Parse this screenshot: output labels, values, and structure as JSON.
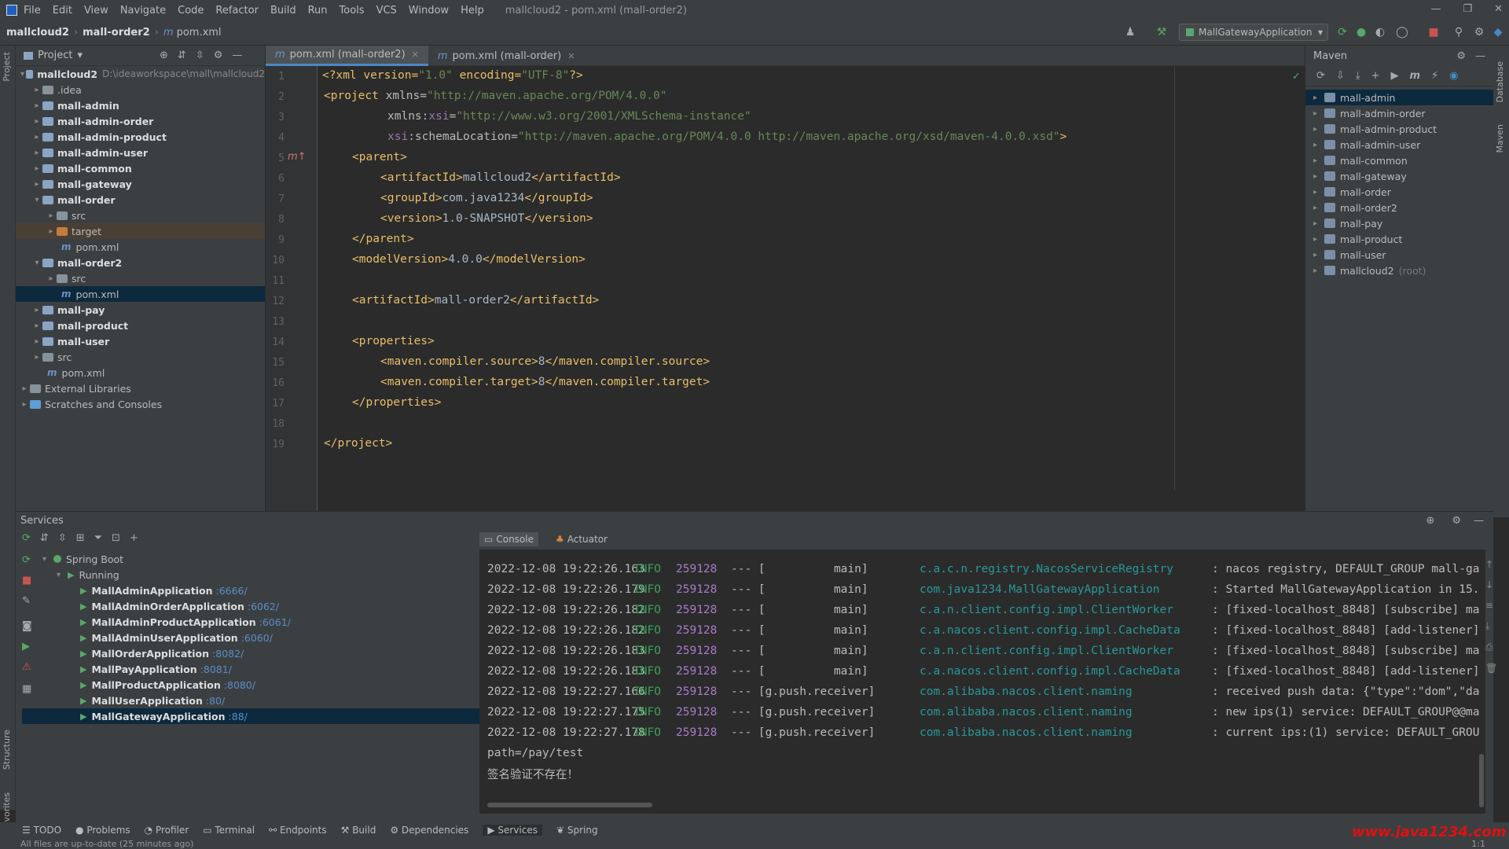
{
  "menu": {
    "items": [
      "File",
      "Edit",
      "View",
      "Navigate",
      "Code",
      "Refactor",
      "Build",
      "Run",
      "Tools",
      "VCS",
      "Window",
      "Help"
    ],
    "window_title": "mallcloud2 - pom.xml (mall-order2)"
  },
  "breadcrumb": [
    "mallcloud2",
    "mall-order2",
    "pom.xml"
  ],
  "run_config": "MallGatewayApplication",
  "project": {
    "header": "Project",
    "root_name": "mallcloud2",
    "root_path": "D:\\ideaworkspace\\mall\\mallcloud2",
    "items": [
      ".idea",
      "mall-admin",
      "mall-admin-order",
      "mall-admin-product",
      "mall-admin-user",
      "mall-common",
      "mall-gateway",
      "mall-order",
      "src",
      "target",
      "pom.xml",
      "mall-order2",
      "src",
      "pom.xml",
      "mall-pay",
      "mall-product",
      "mall-user",
      "src",
      "pom.xml",
      "External Libraries",
      "Scratches and Consoles"
    ]
  },
  "tabs": [
    "pom.xml (mall-order2)",
    "pom.xml (mall-order)"
  ],
  "code": {
    "l1a": "<?xml version=",
    "l1b": "\"1.0\"",
    "l1c": " encoding=",
    "l1d": "\"UTF-8\"",
    "l1e": "?>",
    "l2a": "<project ",
    "l2b": "xmlns=",
    "l2c": "\"http://maven.apache.org/POM/4.0.0\"",
    "l3a": "xmlns:",
    "l3b": "xsi",
    "l3c": "=",
    "l3d": "\"http://www.w3.org/2001/XMLSchema-instance\"",
    "l4a": "xsi",
    "l4b": ":schemaLocation=",
    "l4c": "\"http://maven.apache.org/POM/4.0.0 http://maven.apache.org/xsd/maven-4.0.0.xsd\"",
    "l4d": ">",
    "l5": "<parent>",
    "l6a": "<artifactId>",
    "l6b": "mallcloud2",
    "l6c": "</artifactId>",
    "l7a": "<groupId>",
    "l7b": "com.java1234",
    "l7c": "</groupId>",
    "l8a": "<version>",
    "l8b": "1.0-SNAPSHOT",
    "l8c": "</version>",
    "l9": "</parent>",
    "l10a": "<modelVersion>",
    "l10b": "4.0.0",
    "l10c": "</modelVersion>",
    "l12a": "<artifactId>",
    "l12b": "mall-order2",
    "l12c": "</artifactId>",
    "l14": "<properties>",
    "l15a": "<maven.compiler.source>",
    "l15b": "8",
    "l15c": "</maven.compiler.source>",
    "l16a": "<maven.compiler.target>",
    "l16b": "8",
    "l16c": "</maven.compiler.target>",
    "l17": "</properties>",
    "l19": "</project>"
  },
  "maven": {
    "header": "Maven",
    "items": [
      "mall-admin",
      "mall-admin-order",
      "mall-admin-product",
      "mall-admin-user",
      "mall-common",
      "mall-gateway",
      "mall-order",
      "mall-order2",
      "mall-pay",
      "mall-product",
      "mall-user",
      "mallcloud2"
    ],
    "root_label": "(root)"
  },
  "services": {
    "header": "Services",
    "group": "Spring Boot",
    "running": "Running",
    "apps": [
      {
        "name": "MallAdminApplication",
        "port": ":6666/"
      },
      {
        "name": "MallAdminOrderApplication",
        "port": ":6062/"
      },
      {
        "name": "MallAdminProductApplication",
        "port": ":6061/"
      },
      {
        "name": "MallAdminUserApplication",
        "port": ":6060/"
      },
      {
        "name": "MallOrderApplication",
        "port": ":8082/"
      },
      {
        "name": "MallPayApplication",
        "port": ":8081/"
      },
      {
        "name": "MallProductApplication",
        "port": ":8080/"
      },
      {
        "name": "MallUserApplication",
        "port": ":80/"
      },
      {
        "name": "MallGatewayApplication",
        "port": ":88/"
      }
    ],
    "console_tabs": [
      "Console",
      "Actuator"
    ]
  },
  "log": [
    {
      "d": "2022-12-08 19:22:26.163",
      "lv": "INFO",
      "pid": "259128",
      "th": "--- [          main]",
      "cls": "c.a.c.n.registry.NacosServiceRegistry",
      "msg": ": nacos registry, DEFAULT_GROUP mall-ga"
    },
    {
      "d": "2022-12-08 19:22:26.179",
      "lv": "INFO",
      "pid": "259128",
      "th": "--- [          main]",
      "cls": "com.java1234.MallGatewayApplication",
      "msg": ": Started MallGatewayApplication in 15."
    },
    {
      "d": "2022-12-08 19:22:26.182",
      "lv": "INFO",
      "pid": "259128",
      "th": "--- [          main]",
      "cls": "c.a.n.client.config.impl.ClientWorker",
      "msg": ": [fixed-localhost_8848] [subscribe] ma"
    },
    {
      "d": "2022-12-08 19:22:26.182",
      "lv": "INFO",
      "pid": "259128",
      "th": "--- [          main]",
      "cls": "c.a.nacos.client.config.impl.CacheData",
      "msg": ": [fixed-localhost_8848] [add-listener]"
    },
    {
      "d": "2022-12-08 19:22:26.183",
      "lv": "INFO",
      "pid": "259128",
      "th": "--- [          main]",
      "cls": "c.a.n.client.config.impl.ClientWorker",
      "msg": ": [fixed-localhost_8848] [subscribe] ma"
    },
    {
      "d": "2022-12-08 19:22:26.183",
      "lv": "INFO",
      "pid": "259128",
      "th": "--- [          main]",
      "cls": "c.a.nacos.client.config.impl.CacheData",
      "msg": ": [fixed-localhost_8848] [add-listener]"
    },
    {
      "d": "2022-12-08 19:22:27.166",
      "lv": "INFO",
      "pid": "259128",
      "th": "--- [g.push.receiver]",
      "cls": "com.alibaba.nacos.client.naming",
      "msg": ": received push data: {\"type\":\"dom\",\"da"
    },
    {
      "d": "2022-12-08 19:22:27.175",
      "lv": "INFO",
      "pid": "259128",
      "th": "--- [g.push.receiver]",
      "cls": "com.alibaba.nacos.client.naming",
      "msg": ": new ips(1) service: DEFAULT_GROUP@@ma"
    },
    {
      "d": "2022-12-08 19:22:27.178",
      "lv": "INFO",
      "pid": "259128",
      "th": "--- [g.push.receiver]",
      "cls": "com.alibaba.nacos.client.naming",
      "msg": ": current ips:(1) service: DEFAULT_GROU"
    }
  ],
  "log_path": "path=/pay/test",
  "log_msg": "签名验证不存在！",
  "bottom_tabs": [
    "TODO",
    "Problems",
    "Profiler",
    "Terminal",
    "Endpoints",
    "Build",
    "Dependencies",
    "Services",
    "Spring"
  ],
  "status": "All files are up-to-date (25 minutes ago)",
  "watermark": "www.java1234.com",
  "position": "1:1"
}
